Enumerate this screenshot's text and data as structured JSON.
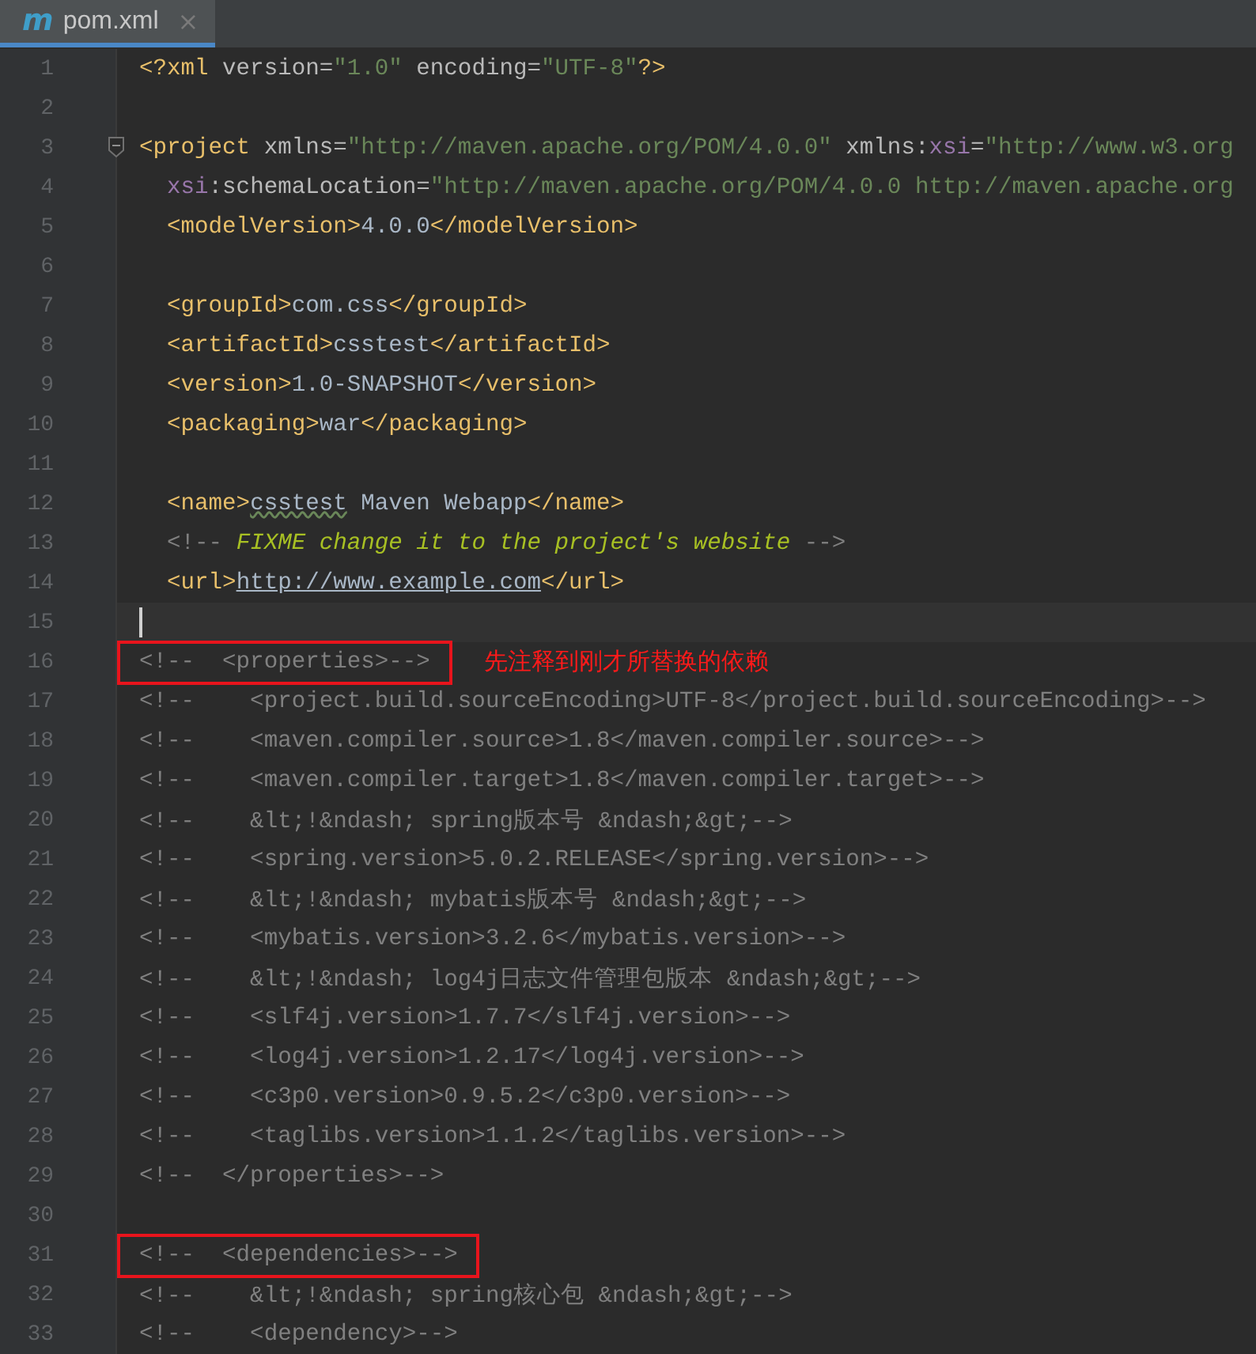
{
  "tab": {
    "icon": "m",
    "title": "pom.xml",
    "close": "×",
    "selected": true
  },
  "lines": [
    {
      "number": "1",
      "tokens": [
        {
          "kind": "tag",
          "text": "<?xml "
        },
        {
          "kind": "attr",
          "text": "version="
        },
        {
          "kind": "string",
          "text": "\"1.0\""
        },
        {
          "kind": "attr",
          "text": " encoding="
        },
        {
          "kind": "string",
          "text": "\"UTF-8\""
        },
        {
          "kind": "tag",
          "text": "?>"
        }
      ]
    },
    {
      "number": "2"
    },
    {
      "number": "3",
      "fold": true,
      "tokens": [
        {
          "kind": "tag",
          "text": "<project "
        },
        {
          "kind": "attr",
          "text": "xmlns="
        },
        {
          "kind": "string",
          "text": "\"http://maven.apache.org/POM/4.0.0\""
        },
        {
          "kind": "attr",
          "text": " xmlns:"
        },
        {
          "kind": "ns",
          "text": "xsi"
        },
        {
          "kind": "attr",
          "text": "="
        },
        {
          "kind": "string",
          "text": "\"http://www.w3.org"
        }
      ]
    },
    {
      "number": "4",
      "tokens": [
        {
          "kind": "ns",
          "text": "  xsi"
        },
        {
          "kind": "attr",
          "text": ":schemaLocation="
        },
        {
          "kind": "string",
          "text": "\"http://maven.apache.org/POM/4.0.0 http://maven.apache.org"
        }
      ]
    },
    {
      "number": "5",
      "tokens": [
        {
          "kind": "tag",
          "text": "  <modelVersion>"
        },
        {
          "kind": "text",
          "text": "4.0.0"
        },
        {
          "kind": "tag",
          "text": "</modelVersion>"
        }
      ]
    },
    {
      "number": "6"
    },
    {
      "number": "7",
      "tokens": [
        {
          "kind": "tag",
          "text": "  <groupId>"
        },
        {
          "kind": "text",
          "text": "com.css"
        },
        {
          "kind": "tag",
          "text": "</groupId>"
        }
      ]
    },
    {
      "number": "8",
      "tokens": [
        {
          "kind": "tag",
          "text": "  <artifactId>"
        },
        {
          "kind": "text",
          "text": "csstest"
        },
        {
          "kind": "tag",
          "text": "</artifactId>"
        }
      ]
    },
    {
      "number": "9",
      "tokens": [
        {
          "kind": "tag",
          "text": "  <version>"
        },
        {
          "kind": "text",
          "text": "1.0-SNAPSHOT"
        },
        {
          "kind": "tag",
          "text": "</version>"
        }
      ]
    },
    {
      "number": "10",
      "tokens": [
        {
          "kind": "tag",
          "text": "  <packaging>"
        },
        {
          "kind": "text",
          "text": "war"
        },
        {
          "kind": "tag",
          "text": "</packaging>"
        }
      ]
    },
    {
      "number": "11"
    },
    {
      "number": "12",
      "tokens": [
        {
          "kind": "tag",
          "text": "  <name>"
        },
        {
          "kind": "typo",
          "text": "csstest"
        },
        {
          "kind": "text",
          "text": " Maven Webapp"
        },
        {
          "kind": "tag",
          "text": "</name>"
        }
      ]
    },
    {
      "number": "13",
      "tokens": [
        {
          "kind": "comment",
          "text": "  <!-- "
        },
        {
          "kind": "todo",
          "text": "FIXME change it to the project's website"
        },
        {
          "kind": "comment",
          "text": " -->"
        }
      ]
    },
    {
      "number": "14",
      "tokens": [
        {
          "kind": "tag",
          "text": "  <url>"
        },
        {
          "kind": "link",
          "text": "http://www.example.com"
        },
        {
          "kind": "tag",
          "text": "</url>"
        }
      ]
    },
    {
      "number": "15",
      "caret": true
    },
    {
      "number": "16",
      "boxed": true,
      "note": "先注释到刚才所替换的依赖",
      "tokens": [
        {
          "kind": "comment",
          "text": "<!--  <properties>-->"
        }
      ]
    },
    {
      "number": "17",
      "tokens": [
        {
          "kind": "comment",
          "text": "<!--    <project.build.sourceEncoding>UTF-8</project.build.sourceEncoding>-->"
        }
      ]
    },
    {
      "number": "18",
      "tokens": [
        {
          "kind": "comment",
          "text": "<!--    <maven.compiler.source>1.8</maven.compiler.source>-->"
        }
      ]
    },
    {
      "number": "19",
      "tokens": [
        {
          "kind": "comment",
          "text": "<!--    <maven.compiler.target>1.8</maven.compiler.target>-->"
        }
      ]
    },
    {
      "number": "20",
      "tokens": [
        {
          "kind": "comment",
          "text": "<!--    &lt;!&ndash; spring版本号 &ndash;&gt;-->"
        }
      ]
    },
    {
      "number": "21",
      "tokens": [
        {
          "kind": "comment",
          "text": "<!--    <spring.version>5.0.2.RELEASE</spring.version>-->"
        }
      ]
    },
    {
      "number": "22",
      "tokens": [
        {
          "kind": "comment",
          "text": "<!--    &lt;!&ndash; mybatis版本号 &ndash;&gt;-->"
        }
      ]
    },
    {
      "number": "23",
      "tokens": [
        {
          "kind": "comment",
          "text": "<!--    <mybatis.version>3.2.6</mybatis.version>-->"
        }
      ]
    },
    {
      "number": "24",
      "tokens": [
        {
          "kind": "comment",
          "text": "<!--    &lt;!&ndash; log4j日志文件管理包版本 &ndash;&gt;-->"
        }
      ]
    },
    {
      "number": "25",
      "tokens": [
        {
          "kind": "comment",
          "text": "<!--    <slf4j.version>1.7.7</slf4j.version>-->"
        }
      ]
    },
    {
      "number": "26",
      "tokens": [
        {
          "kind": "comment",
          "text": "<!--    <log4j.version>1.2.17</log4j.version>-->"
        }
      ]
    },
    {
      "number": "27",
      "tokens": [
        {
          "kind": "comment",
          "text": "<!--    <c3p0.version>0.9.5.2</c3p0.version>-->"
        }
      ]
    },
    {
      "number": "28",
      "tokens": [
        {
          "kind": "comment",
          "text": "<!--    <taglibs.version>1.1.2</taglibs.version>-->"
        }
      ]
    },
    {
      "number": "29",
      "tokens": [
        {
          "kind": "comment",
          "text": "<!--  </properties>-->"
        }
      ]
    },
    {
      "number": "30"
    },
    {
      "number": "31",
      "boxed": true,
      "tokens": [
        {
          "kind": "comment",
          "text": "<!--  <dependencies>-->"
        }
      ]
    },
    {
      "number": "32",
      "tokens": [
        {
          "kind": "comment",
          "text": "<!--    &lt;!&ndash; spring核心包 &ndash;&gt;-->"
        }
      ]
    },
    {
      "number": "33",
      "tokens": [
        {
          "kind": "comment",
          "text": "<!--    <dependency>-->"
        }
      ]
    }
  ]
}
